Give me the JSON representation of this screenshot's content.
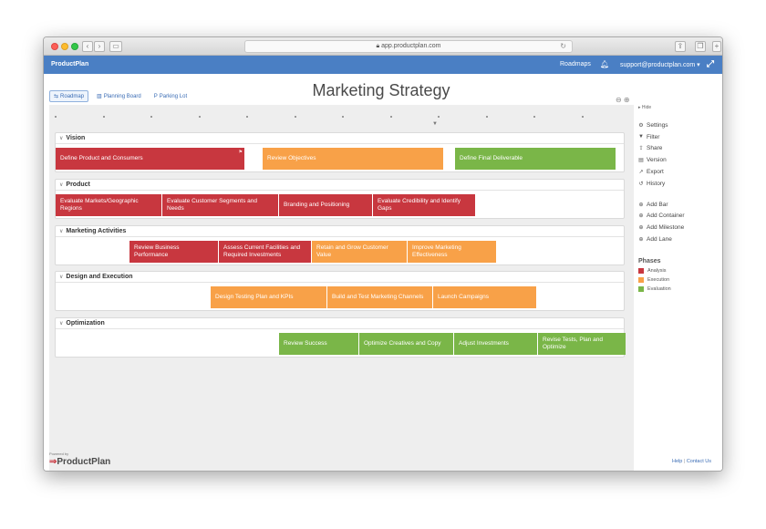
{
  "browser": {
    "url": "app.productplan.com",
    "back_label": "‹",
    "forward_label": "›"
  },
  "header": {
    "brand": "ProductPlan",
    "roadmaps_link": "Roadmaps",
    "user": "support@productplan.com ▾"
  },
  "view_tabs": [
    {
      "label": "Roadmap",
      "icon": "roadmap-icon",
      "glyph": "⇆"
    },
    {
      "label": "Planning Board",
      "icon": "board-icon",
      "glyph": "▥"
    },
    {
      "label": "Parking Lot",
      "icon": "parking-icon",
      "glyph": "P"
    }
  ],
  "page_title": "Marketing Strategy",
  "lanes": [
    {
      "name": "Vision",
      "bars": [
        {
          "label": "Define Product and Consumers",
          "phase": "analysis"
        },
        {
          "label": "Review Objectives",
          "phase": "execution"
        },
        {
          "label": "Define Final Deliverable",
          "phase": "evaluation"
        }
      ]
    },
    {
      "name": "Product",
      "bars": [
        {
          "label": "Evaluate Markets/Geographic Regions",
          "phase": "analysis"
        },
        {
          "label": "Evaluate Customer Segments and Needs",
          "phase": "analysis"
        },
        {
          "label": "Branding and Positioning",
          "phase": "analysis"
        },
        {
          "label": "Evaluate Credibility and Identify Gaps",
          "phase": "analysis"
        }
      ]
    },
    {
      "name": "Marketing Activities",
      "bars": [
        {
          "label": "Review Business Performance",
          "phase": "analysis"
        },
        {
          "label": "Assess Current Facilities and Required Investments",
          "phase": "analysis"
        },
        {
          "label": "Retain and Grow Customer Value",
          "phase": "execution"
        },
        {
          "label": "Improve Marketing Effectiveness",
          "phase": "execution"
        }
      ]
    },
    {
      "name": "Design and Execution",
      "bars": [
        {
          "label": "Design Testing Plan and KPIs",
          "phase": "execution"
        },
        {
          "label": "Build and Test Marketing Channels",
          "phase": "execution"
        },
        {
          "label": "Launch Campaigns",
          "phase": "execution"
        }
      ]
    },
    {
      "name": "Optimization",
      "bars": [
        {
          "label": "Review Success",
          "phase": "evaluation"
        },
        {
          "label": "Optimize Creatives and Copy",
          "phase": "evaluation"
        },
        {
          "label": "Adjust Investments",
          "phase": "evaluation"
        },
        {
          "label": "Revise Tests, Plan and Optimize",
          "phase": "evaluation"
        }
      ]
    }
  ],
  "sidebar": {
    "hide_label": "Hide",
    "tools": [
      {
        "label": "Settings",
        "icon": "gear-icon",
        "glyph": "⚙"
      },
      {
        "label": "Filter",
        "icon": "filter-icon",
        "glyph": "▼"
      },
      {
        "label": "Share",
        "icon": "share-icon",
        "glyph": "⇪"
      },
      {
        "label": "Version",
        "icon": "version-icon",
        "glyph": "▤"
      },
      {
        "label": "Export",
        "icon": "export-icon",
        "glyph": "↗"
      },
      {
        "label": "History",
        "icon": "history-icon",
        "glyph": "↺"
      }
    ],
    "adds": [
      {
        "label": "Add Bar",
        "icon": "plus-icon",
        "glyph": "⊕"
      },
      {
        "label": "Add Container",
        "icon": "plus-icon",
        "glyph": "⊕"
      },
      {
        "label": "Add Milestone",
        "icon": "plus-icon",
        "glyph": "⊕"
      },
      {
        "label": "Add Lane",
        "icon": "plus-icon",
        "glyph": "⊕"
      }
    ],
    "phases_title": "Phases",
    "phases": [
      {
        "label": "Analysis",
        "color": "#c8373f"
      },
      {
        "label": "Execution",
        "color": "#f8a148"
      },
      {
        "label": "Evaluation",
        "color": "#7ab648"
      }
    ]
  },
  "footer": {
    "powered_by": "Powered by",
    "logo": "ProductPlan",
    "help": "Help",
    "contact": "Contact Us"
  }
}
